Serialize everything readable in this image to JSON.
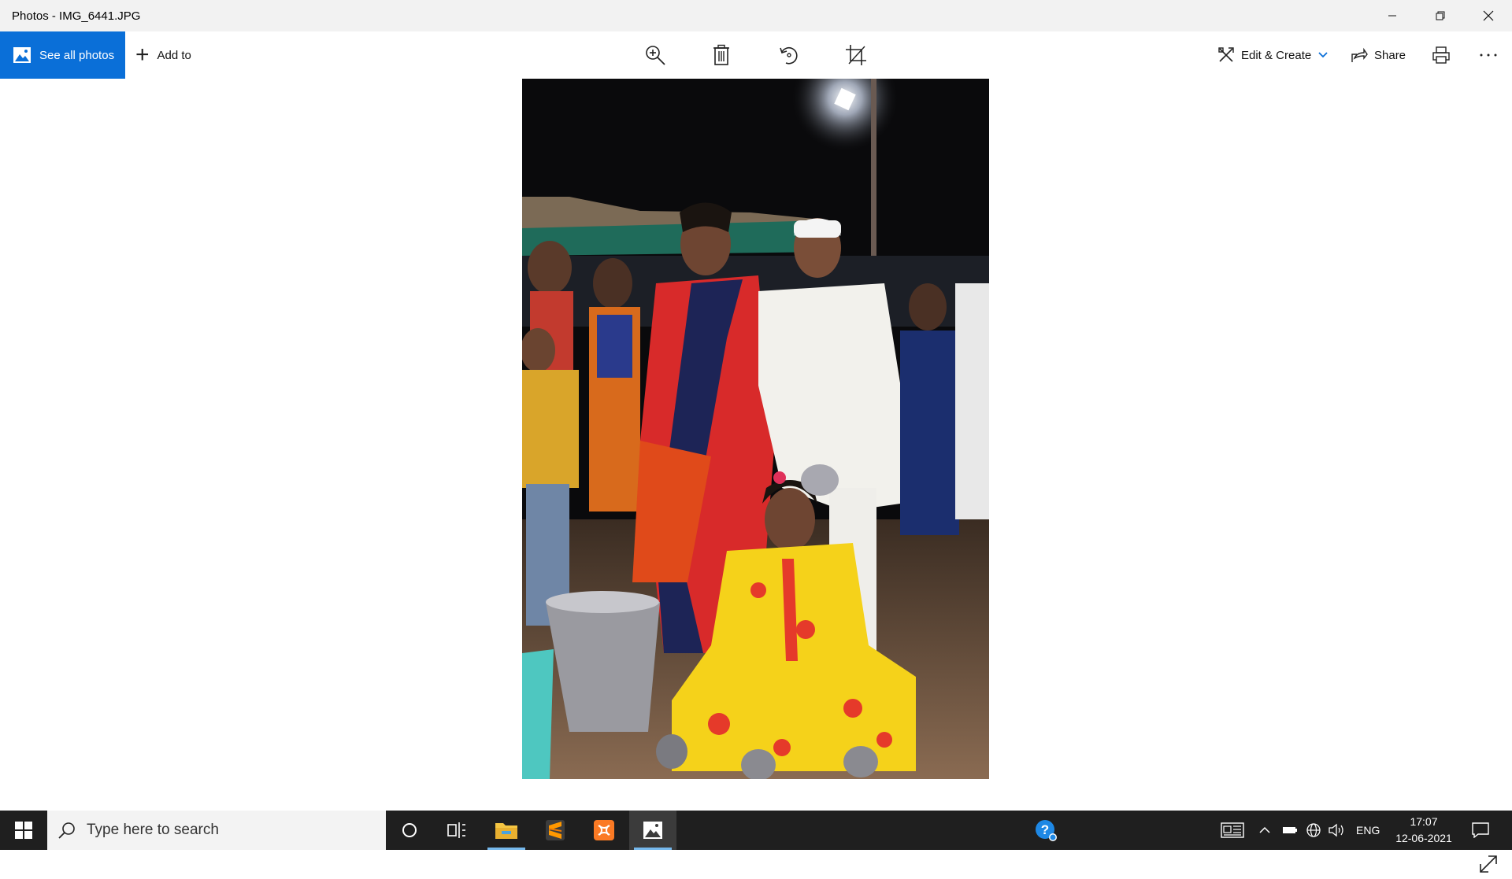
{
  "window": {
    "title": "Photos - IMG_6441.JPG"
  },
  "toolbar": {
    "see_all_label": "See all photos",
    "add_to_label": "Add to",
    "edit_create_label": "Edit & Create",
    "share_label": "Share"
  },
  "colors": {
    "accent": "#0a6fd8",
    "taskbar": "#1f1f1f",
    "titlebar": "#f2f2f2"
  },
  "icons": [
    "photos-icon",
    "plus-icon",
    "zoom-in-icon",
    "delete-icon",
    "rotate-icon",
    "crop-icon",
    "edit-create-icon",
    "chevron-down-icon",
    "share-icon",
    "print-icon",
    "more-icon",
    "expand-icon",
    "windows-start-icon",
    "search-icon",
    "cortana-icon",
    "task-view-icon",
    "file-explorer-icon",
    "sublime-text-icon",
    "xampp-icon",
    "photos-app-icon",
    "help-icon",
    "news-icon",
    "chevron-up-icon",
    "battery-icon",
    "network-icon",
    "volume-icon",
    "notifications-icon"
  ],
  "taskbar": {
    "search_placeholder": "Type here to search",
    "language": "ENG",
    "time": "17:07",
    "date": "12-06-2021"
  }
}
